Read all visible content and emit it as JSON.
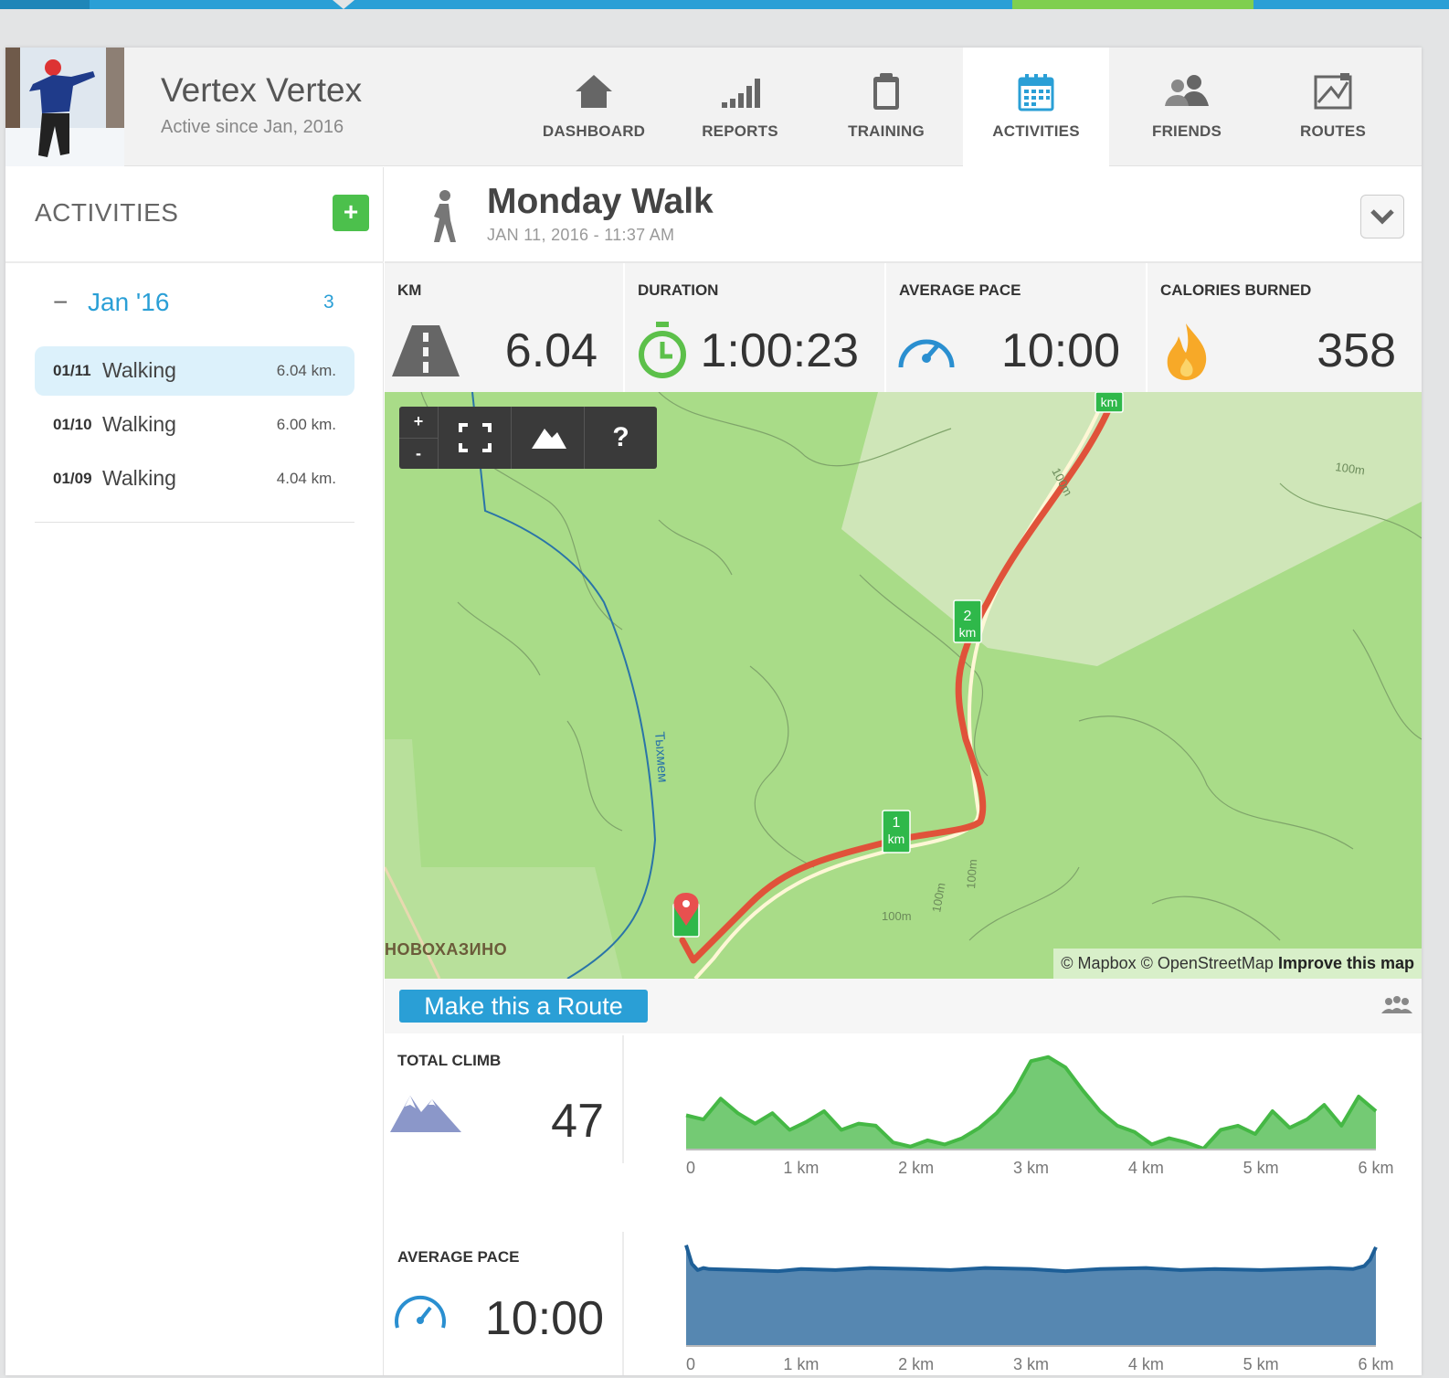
{
  "user": {
    "name": "Vertex Vertex",
    "since": "Active since Jan, 2016"
  },
  "nav": [
    {
      "label": "DASHBOARD",
      "icon": "home-icon"
    },
    {
      "label": "REPORTS",
      "icon": "bars-icon"
    },
    {
      "label": "TRAINING",
      "icon": "clipboard-icon"
    },
    {
      "label": "ACTIVITIES",
      "icon": "calendar-icon",
      "active": true
    },
    {
      "label": "FRIENDS",
      "icon": "friends-icon"
    },
    {
      "label": "ROUTES",
      "icon": "route-map-icon"
    }
  ],
  "sidebar": {
    "title": "ACTIVITIES",
    "add_label": "+",
    "month": {
      "toggle": "−",
      "name": "Jan '16",
      "count": "3"
    },
    "items": [
      {
        "date": "01/11",
        "type": "Walking",
        "distance": "6.04 km.",
        "selected": true
      },
      {
        "date": "01/10",
        "type": "Walking",
        "distance": "6.00 km."
      },
      {
        "date": "01/09",
        "type": "Walking",
        "distance": "4.04 km."
      }
    ]
  },
  "activity": {
    "title": "Monday Walk",
    "datetime": "JAN 11, 2016  -  11:37 AM",
    "stats": [
      {
        "label": "KM",
        "value": "6.04",
        "icon": "road-icon"
      },
      {
        "label": "DURATION",
        "value": "1:00:23",
        "icon": "stopwatch-icon"
      },
      {
        "label": "AVERAGE PACE",
        "value": "10:00",
        "icon": "speedometer-icon"
      },
      {
        "label": "CALORIES BURNED",
        "value": "358",
        "icon": "flame-icon"
      }
    ]
  },
  "map": {
    "zoom_in": "+",
    "zoom_out": "-",
    "help": "?",
    "town_label": "НОВОХАЗИНО",
    "river_label": "Тыхмем",
    "contour_label": "100m",
    "km_marker_label": "km",
    "km_markers": [
      "1",
      "2"
    ],
    "attribution": "© Mapbox © OpenStreetMap",
    "improve": "Improve this map",
    "route_color": "#e0523a"
  },
  "route_button": "Make this a Route",
  "metrics": {
    "climb": {
      "label": "TOTAL CLIMB",
      "value": "47",
      "icon": "mountain-icon"
    },
    "pace": {
      "label": "AVERAGE PACE",
      "value": "10:00",
      "icon": "speedometer-icon"
    }
  },
  "chart_data": [
    {
      "type": "area",
      "xlabel": "",
      "ylabel": "",
      "x": [
        0,
        0.15,
        0.3,
        0.45,
        0.6,
        0.75,
        0.9,
        1.05,
        1.2,
        1.35,
        1.5,
        1.65,
        1.8,
        1.95,
        2.1,
        2.25,
        2.4,
        2.55,
        2.7,
        2.85,
        3.0,
        3.15,
        3.3,
        3.45,
        3.6,
        3.75,
        3.9,
        4.05,
        4.2,
        4.35,
        4.5,
        4.65,
        4.8,
        4.95,
        5.1,
        5.25,
        5.4,
        5.55,
        5.7,
        5.85,
        6.0
      ],
      "values": [
        32,
        28,
        48,
        34,
        24,
        34,
        18,
        26,
        36,
        18,
        24,
        22,
        6,
        2,
        8,
        4,
        10,
        20,
        34,
        54,
        84,
        88,
        78,
        56,
        36,
        22,
        16,
        4,
        10,
        6,
        0,
        18,
        22,
        14,
        36,
        20,
        28,
        42,
        22,
        50,
        36
      ],
      "xticks": [
        "0",
        "1 km",
        "2 km",
        "3 km",
        "4 km",
        "5 km",
        "6 km"
      ],
      "ylim": [
        0,
        100
      ],
      "color": "#45b845"
    },
    {
      "type": "area",
      "xlabel": "",
      "ylabel": "",
      "x": [
        0,
        0.05,
        0.1,
        0.15,
        0.2,
        0.5,
        0.8,
        1.0,
        1.3,
        1.6,
        2.0,
        2.3,
        2.6,
        3.0,
        3.3,
        3.6,
        4.0,
        4.3,
        4.6,
        5.0,
        5.3,
        5.6,
        5.8,
        5.9,
        5.95,
        6.0
      ],
      "values": [
        96,
        78,
        72,
        74,
        73,
        72,
        71,
        73,
        72,
        74,
        73,
        72,
        74,
        73,
        71,
        73,
        74,
        72,
        73,
        72,
        73,
        74,
        73,
        76,
        82,
        94
      ],
      "xticks": [
        "0",
        "1 km",
        "2 km",
        "3 km",
        "4 km",
        "5 km",
        "6 km"
      ],
      "ylim": [
        0,
        100
      ],
      "color": "#1e5f97"
    }
  ]
}
